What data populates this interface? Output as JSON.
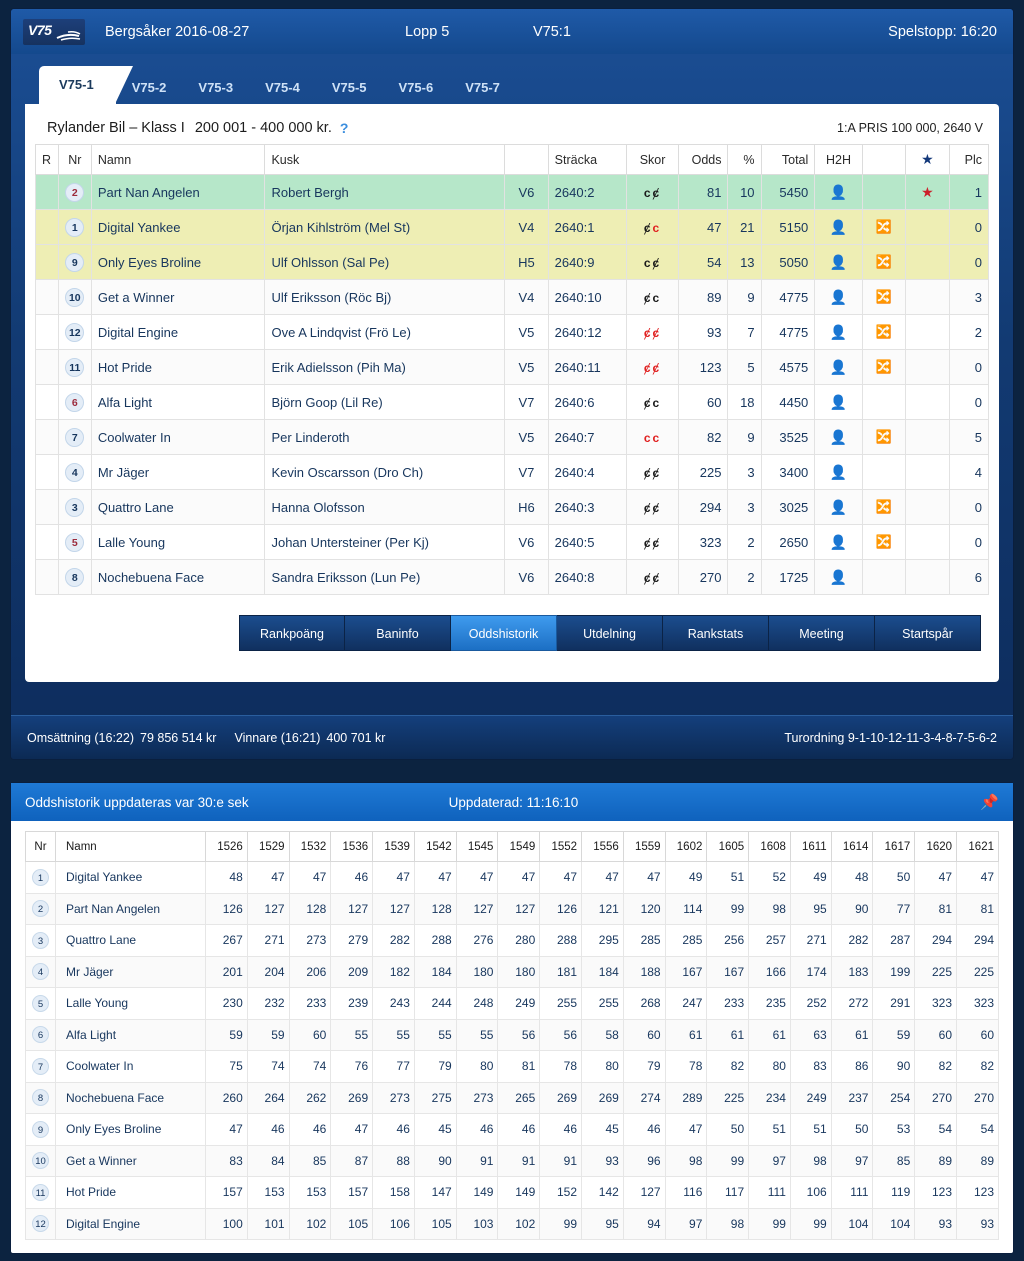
{
  "header": {
    "logo_text": "V75",
    "track_date": "Bergsåker 2016-08-27",
    "race": "Lopp 5",
    "leg": "V75:1",
    "deadline": "Spelstopp: 16:20"
  },
  "tabs": [
    {
      "label": "V75-1",
      "active": true
    },
    {
      "label": "V75-2",
      "active": false
    },
    {
      "label": "V75-3",
      "active": false
    },
    {
      "label": "V75-4",
      "active": false
    },
    {
      "label": "V75-5",
      "active": false
    },
    {
      "label": "V75-6",
      "active": false
    },
    {
      "label": "V75-7",
      "active": false
    }
  ],
  "race_info": {
    "name": "Rylander Bil – Klass I",
    "purse_range": "200 001 - 400 000 kr.",
    "help_icon": "question-mark-icon",
    "prize": "1:A PRIS 100 000, 2640 V"
  },
  "startlist": {
    "columns": [
      "R",
      "Nr",
      "Namn",
      "Kusk",
      "",
      "Sträcka",
      "Skor",
      "Odds",
      "%",
      "Total",
      "H2H",
      "",
      "★",
      "Plc"
    ],
    "rows": [
      {
        "r": "",
        "nr": "2",
        "nr_red": true,
        "namn": "Part Nan Angelen",
        "kusk": "Robert Bergh",
        "sp": "V6",
        "stracka": "2640:2",
        "skor": [
          {
            "g": "c",
            "red": false
          },
          {
            "g": "ȼ",
            "red": false
          }
        ],
        "odds": "81",
        "pct": "10",
        "total": "5450",
        "h2h": true,
        "shuffle": false,
        "star": "red",
        "plc": "1",
        "hl": "green"
      },
      {
        "r": "",
        "nr": "1",
        "nr_red": false,
        "namn": "Digital Yankee",
        "kusk": "Örjan Kihlström (Mel St)",
        "sp": "V4",
        "stracka": "2640:1",
        "skor": [
          {
            "g": "ȼ",
            "red": false
          },
          {
            "g": "c",
            "red": true
          }
        ],
        "odds": "47",
        "pct": "21",
        "total": "5150",
        "h2h": true,
        "shuffle": true,
        "star": "",
        "plc": "0",
        "hl": "yellow"
      },
      {
        "r": "",
        "nr": "9",
        "nr_red": false,
        "namn": "Only Eyes Broline",
        "kusk": "Ulf Ohlsson (Sal Pe)",
        "sp": "H5",
        "stracka": "2640:9",
        "skor": [
          {
            "g": "c",
            "red": false
          },
          {
            "g": "ȼ",
            "red": false
          }
        ],
        "odds": "54",
        "pct": "13",
        "total": "5050",
        "h2h": true,
        "shuffle": true,
        "star": "",
        "plc": "0",
        "hl": "yellow"
      },
      {
        "r": "",
        "nr": "10",
        "nr_red": false,
        "namn": "Get a Winner",
        "kusk": "Ulf Eriksson (Röc Bj)",
        "sp": "V4",
        "stracka": "2640:10",
        "skor": [
          {
            "g": "ȼ",
            "red": false
          },
          {
            "g": "c",
            "red": false
          }
        ],
        "odds": "89",
        "pct": "9",
        "total": "4775",
        "h2h": true,
        "shuffle": true,
        "star": "",
        "plc": "3",
        "hl": "plain"
      },
      {
        "r": "",
        "nr": "12",
        "nr_red": false,
        "namn": "Digital Engine",
        "kusk": "Ove A Lindqvist (Frö Le)",
        "sp": "V5",
        "stracka": "2640:12",
        "skor": [
          {
            "g": "ȼ",
            "red": true
          },
          {
            "g": "ȼ",
            "red": true
          }
        ],
        "odds": "93",
        "pct": "7",
        "total": "4775",
        "h2h": true,
        "shuffle": true,
        "star": "",
        "plc": "2",
        "hl": "plain"
      },
      {
        "r": "",
        "nr": "11",
        "nr_red": false,
        "namn": "Hot Pride",
        "kusk": "Erik Adielsson (Pih Ma)",
        "sp": "V5",
        "stracka": "2640:11",
        "skor": [
          {
            "g": "ȼ",
            "red": true
          },
          {
            "g": "ȼ",
            "red": true
          }
        ],
        "odds": "123",
        "pct": "5",
        "total": "4575",
        "h2h": true,
        "shuffle": true,
        "star": "",
        "plc": "0",
        "hl": "plain"
      },
      {
        "r": "",
        "nr": "6",
        "nr_red": true,
        "namn": "Alfa Light",
        "kusk": "Björn Goop (Lil Re)",
        "sp": "V7",
        "stracka": "2640:6",
        "skor": [
          {
            "g": "ȼ",
            "red": false
          },
          {
            "g": "c",
            "red": false
          }
        ],
        "odds": "60",
        "pct": "18",
        "total": "4450",
        "h2h": true,
        "shuffle": false,
        "star": "",
        "plc": "0",
        "hl": "plain"
      },
      {
        "r": "",
        "nr": "7",
        "nr_red": false,
        "namn": "Coolwater In",
        "kusk": "Per Linderoth",
        "sp": "V5",
        "stracka": "2640:7",
        "skor": [
          {
            "g": "c",
            "red": true
          },
          {
            "g": "c",
            "red": true
          }
        ],
        "odds": "82",
        "pct": "9",
        "total": "3525",
        "h2h": true,
        "shuffle": true,
        "star": "",
        "plc": "5",
        "hl": "plain"
      },
      {
        "r": "",
        "nr": "4",
        "nr_red": false,
        "namn": "Mr Jäger",
        "kusk": "Kevin Oscarsson (Dro Ch)",
        "sp": "V7",
        "stracka": "2640:4",
        "skor": [
          {
            "g": "ȼ",
            "red": false
          },
          {
            "g": "ȼ",
            "red": false
          }
        ],
        "odds": "225",
        "pct": "3",
        "total": "3400",
        "h2h": true,
        "shuffle": false,
        "star": "",
        "plc": "4",
        "hl": "plain"
      },
      {
        "r": "",
        "nr": "3",
        "nr_red": false,
        "namn": "Quattro Lane",
        "kusk": "Hanna Olofsson",
        "sp": "H6",
        "stracka": "2640:3",
        "skor": [
          {
            "g": "ȼ",
            "red": false
          },
          {
            "g": "ȼ",
            "red": false
          }
        ],
        "odds": "294",
        "pct": "3",
        "total": "3025",
        "h2h": true,
        "shuffle": true,
        "star": "",
        "plc": "0",
        "hl": "plain"
      },
      {
        "r": "",
        "nr": "5",
        "nr_red": true,
        "namn": "Lalle Young",
        "kusk": "Johan Untersteiner (Per Kj)",
        "sp": "V6",
        "stracka": "2640:5",
        "skor": [
          {
            "g": "ȼ",
            "red": false
          },
          {
            "g": "ȼ",
            "red": false
          }
        ],
        "odds": "323",
        "pct": "2",
        "total": "2650",
        "h2h": true,
        "shuffle": true,
        "star": "",
        "plc": "0",
        "hl": "plain"
      },
      {
        "r": "",
        "nr": "8",
        "nr_red": false,
        "namn": "Nochebuena Face",
        "kusk": "Sandra Eriksson (Lun Pe)",
        "sp": "V6",
        "stracka": "2640:8",
        "skor": [
          {
            "g": "ȼ",
            "red": false
          },
          {
            "g": "ȼ",
            "red": false
          }
        ],
        "odds": "270",
        "pct": "2",
        "total": "1725",
        "h2h": true,
        "shuffle": false,
        "star": "",
        "plc": "6",
        "hl": "plain"
      }
    ]
  },
  "action_buttons": [
    {
      "label": "Rankpoäng",
      "active": false
    },
    {
      "label": "Baninfo",
      "active": false
    },
    {
      "label": "Oddshistorik",
      "active": true
    },
    {
      "label": "Utdelning",
      "active": false
    },
    {
      "label": "Rankstats",
      "active": false
    },
    {
      "label": "Meeting",
      "active": false
    },
    {
      "label": "Startspår",
      "active": false
    }
  ],
  "stats_bar": {
    "turnover_label": "Omsättning (16:22)",
    "turnover_value": "79 856 514 kr",
    "winner_label": "Vinnare (16:21)",
    "winner_value": "400 701 kr",
    "order": "Turordning 9-1-10-12-11-3-4-8-7-5-6-2"
  },
  "oddshistory": {
    "title": "Oddshistorik uppdateras var 30:e sek",
    "updated": "Uppdaterad: 11:16:10",
    "pin_icon": "pin-icon",
    "col_nr": "Nr",
    "col_namn": "Namn",
    "times": [
      "1526",
      "1529",
      "1532",
      "1536",
      "1539",
      "1542",
      "1545",
      "1549",
      "1552",
      "1556",
      "1559",
      "1602",
      "1605",
      "1608",
      "1611",
      "1614",
      "1617",
      "1620",
      "1621"
    ],
    "rows": [
      {
        "nr": "1",
        "namn": "Digital Yankee",
        "values": [
          48,
          47,
          47,
          46,
          47,
          47,
          47,
          47,
          47,
          47,
          47,
          49,
          51,
          52,
          49,
          48,
          50,
          47,
          47
        ]
      },
      {
        "nr": "2",
        "namn": "Part Nan Angelen",
        "values": [
          126,
          127,
          128,
          127,
          127,
          128,
          127,
          127,
          126,
          121,
          120,
          114,
          99,
          98,
          95,
          90,
          77,
          81,
          81
        ]
      },
      {
        "nr": "3",
        "namn": "Quattro Lane",
        "values": [
          267,
          271,
          273,
          279,
          282,
          288,
          276,
          280,
          288,
          295,
          285,
          285,
          256,
          257,
          271,
          282,
          287,
          294,
          294
        ]
      },
      {
        "nr": "4",
        "namn": "Mr Jäger",
        "values": [
          201,
          204,
          206,
          209,
          182,
          184,
          180,
          180,
          181,
          184,
          188,
          167,
          167,
          166,
          174,
          183,
          199,
          225,
          225
        ]
      },
      {
        "nr": "5",
        "namn": "Lalle Young",
        "values": [
          230,
          232,
          233,
          239,
          243,
          244,
          248,
          249,
          255,
          255,
          268,
          247,
          233,
          235,
          252,
          272,
          291,
          323,
          323
        ]
      },
      {
        "nr": "6",
        "namn": "Alfa Light",
        "values": [
          59,
          59,
          60,
          55,
          55,
          55,
          55,
          56,
          56,
          58,
          60,
          61,
          61,
          61,
          63,
          61,
          59,
          60,
          60
        ]
      },
      {
        "nr": "7",
        "namn": "Coolwater In",
        "values": [
          75,
          74,
          74,
          76,
          77,
          79,
          80,
          81,
          78,
          80,
          79,
          78,
          82,
          80,
          83,
          86,
          90,
          82,
          82
        ]
      },
      {
        "nr": "8",
        "namn": "Nochebuena Face",
        "values": [
          260,
          264,
          262,
          269,
          273,
          275,
          273,
          265,
          269,
          269,
          274,
          289,
          225,
          234,
          249,
          237,
          254,
          270,
          270
        ]
      },
      {
        "nr": "9",
        "namn": "Only Eyes Broline",
        "values": [
          47,
          46,
          46,
          47,
          46,
          45,
          46,
          46,
          46,
          45,
          46,
          47,
          50,
          51,
          51,
          50,
          53,
          54,
          54
        ]
      },
      {
        "nr": "10",
        "namn": "Get a Winner",
        "values": [
          83,
          84,
          85,
          87,
          88,
          90,
          91,
          91,
          91,
          93,
          96,
          98,
          99,
          97,
          98,
          97,
          85,
          89,
          89
        ]
      },
      {
        "nr": "11",
        "namn": "Hot Pride",
        "values": [
          157,
          153,
          153,
          157,
          158,
          147,
          149,
          149,
          152,
          142,
          127,
          116,
          117,
          111,
          106,
          111,
          119,
          123,
          123
        ]
      },
      {
        "nr": "12",
        "namn": "Digital Engine",
        "values": [
          100,
          101,
          102,
          105,
          106,
          105,
          103,
          102,
          99,
          95,
          94,
          97,
          98,
          99,
          99,
          104,
          104,
          93,
          93
        ]
      }
    ]
  },
  "colors": {
    "brand_blue": "#14498d",
    "accent_blue": "#1f7ad6",
    "row_green": "#b6e7c9",
    "row_yellow": "#eeeeb4",
    "star_red": "#cc1f2a"
  }
}
